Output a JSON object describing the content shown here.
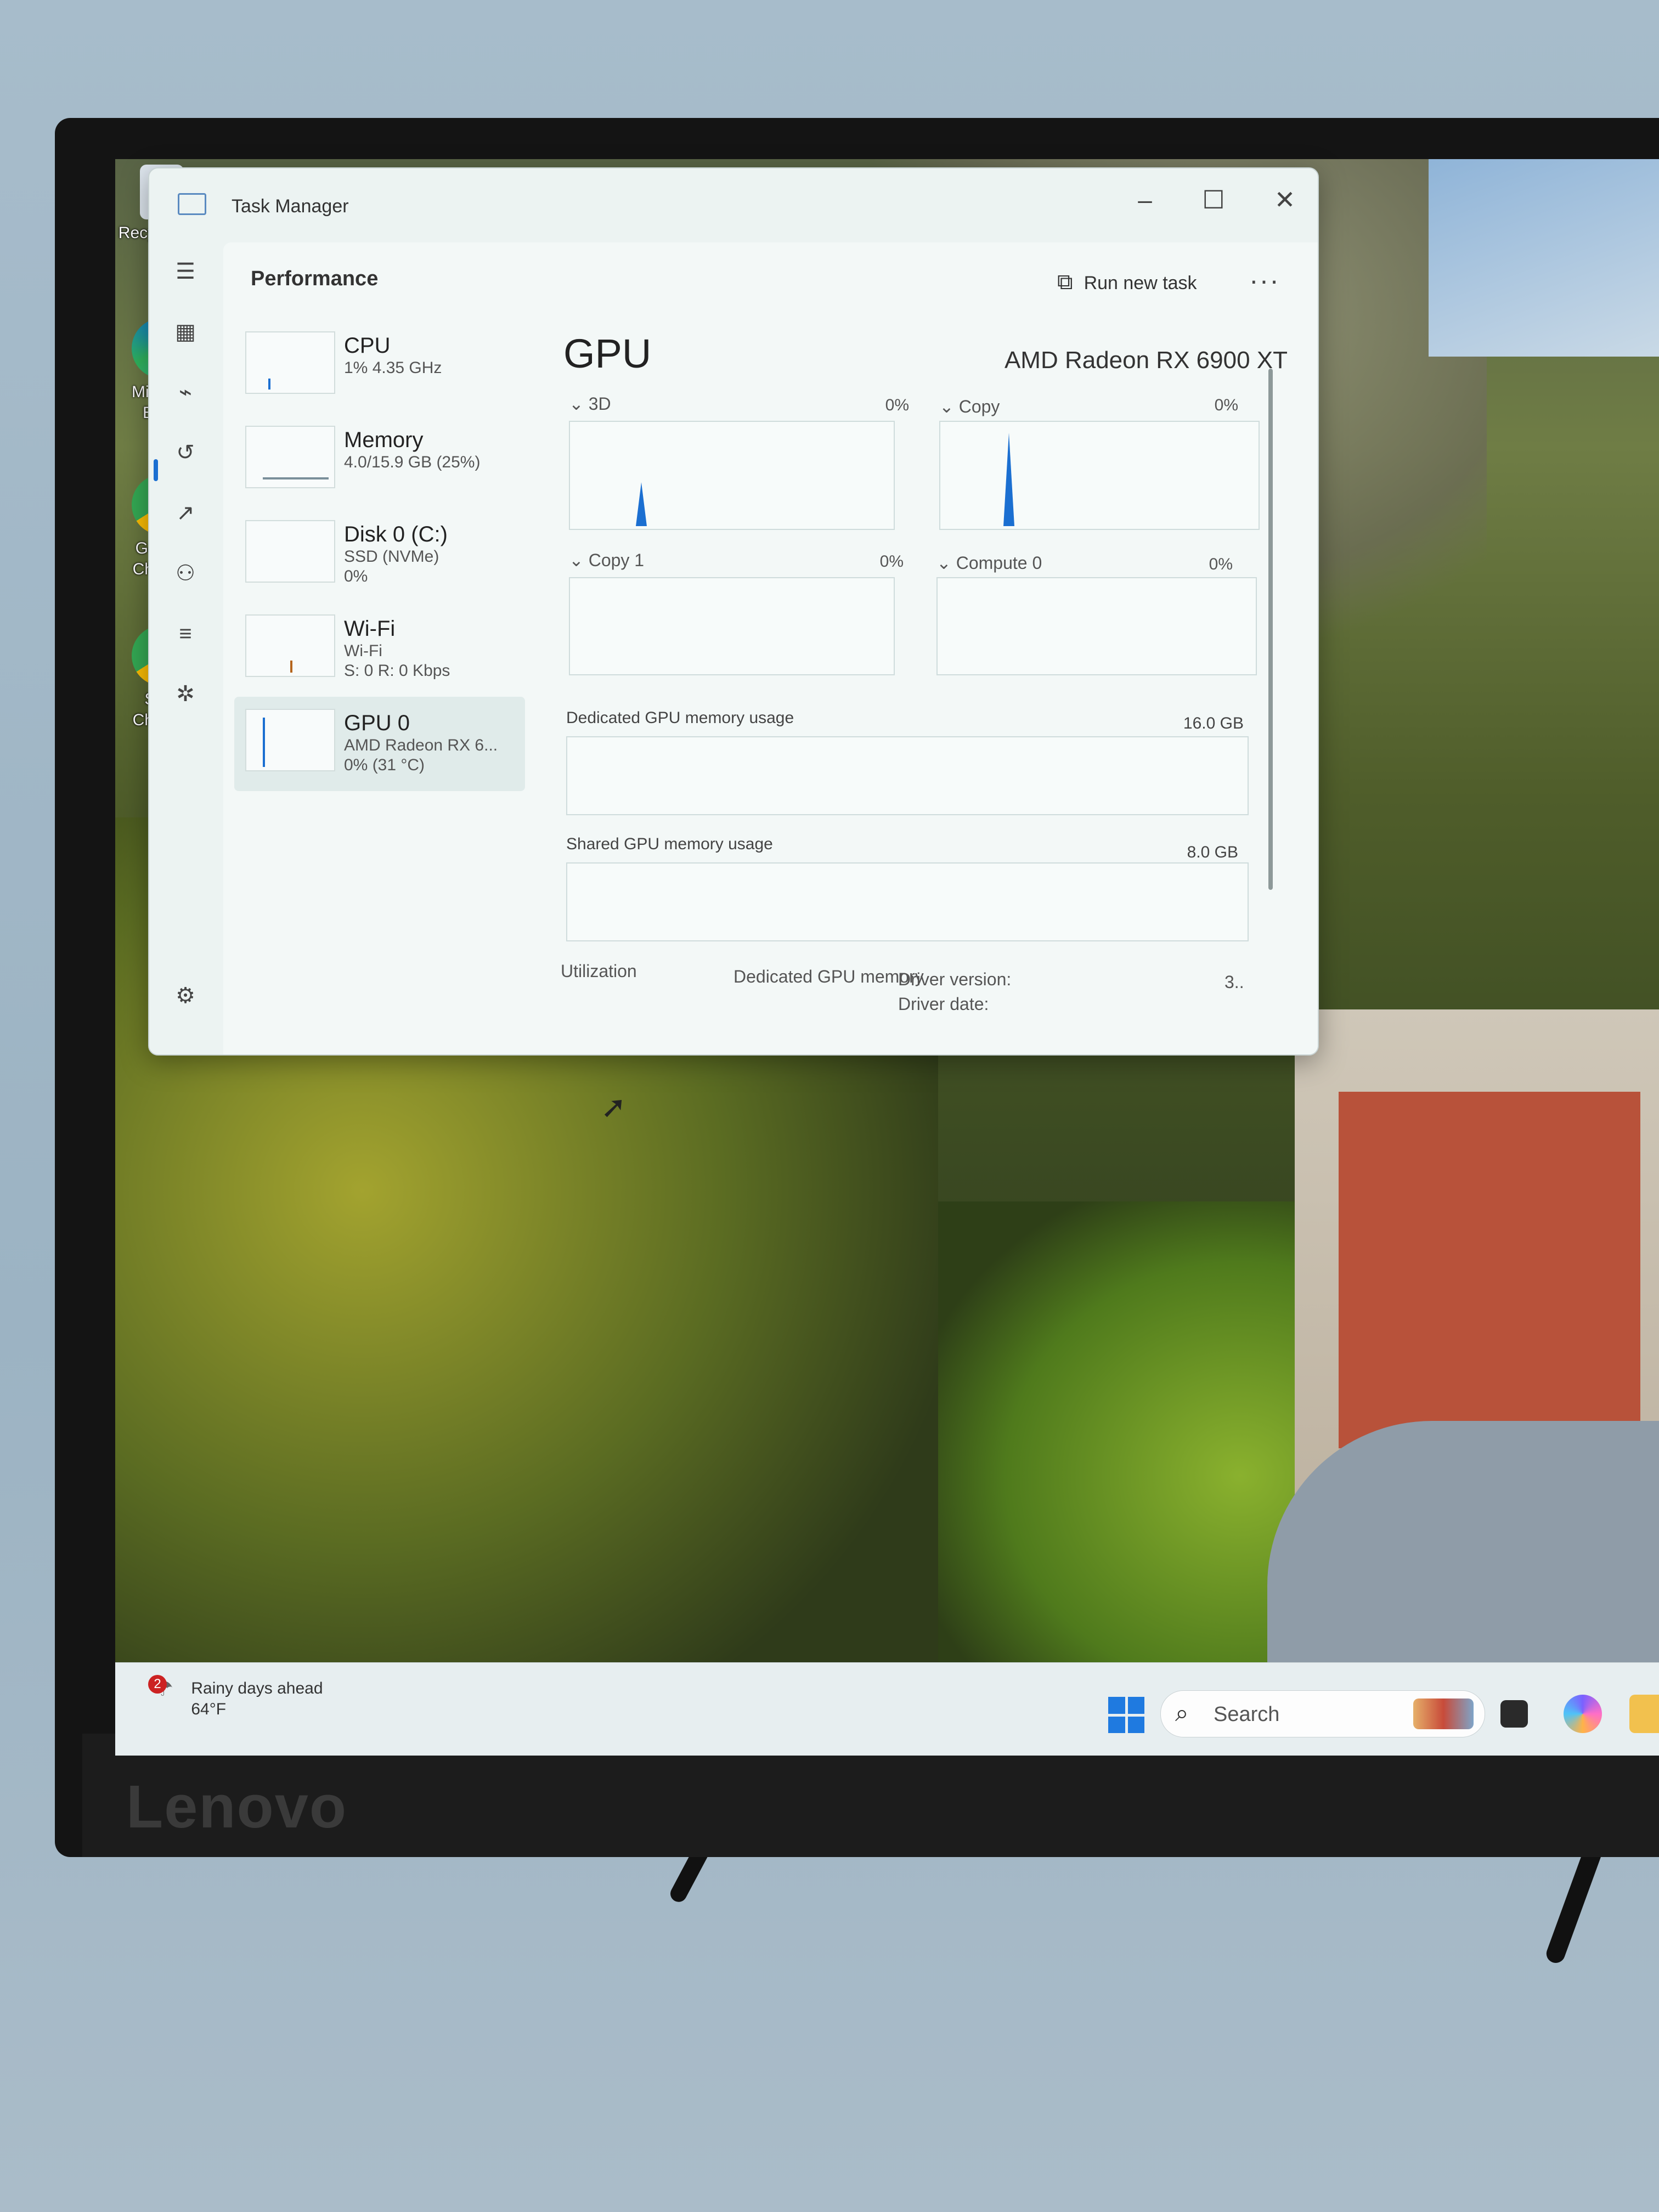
{
  "desktop": {
    "icons": [
      {
        "label": "Recycle Bin",
        "icon": "recycle-bin-icon"
      },
      {
        "label": "Microsoft Edge",
        "icon": "edge-icon"
      },
      {
        "label": "Google Chrome",
        "icon": "chrome-icon"
      },
      {
        "label": "SVG Chrome",
        "icon": "chrome-profile-icon"
      }
    ]
  },
  "monitor": {
    "brand": "Lenovo"
  },
  "task_manager": {
    "title": "Task Manager",
    "page_title": "Performance",
    "run_new_task": "Run new task",
    "more": "···",
    "resources": [
      {
        "name": "CPU",
        "line1": "1% 4.35 GHz",
        "line2": ""
      },
      {
        "name": "Memory",
        "line1": "4.0/15.9 GB (25%)",
        "line2": ""
      },
      {
        "name": "Disk 0 (C:)",
        "line1": "SSD (NVMe)",
        "line2": "0%"
      },
      {
        "name": "Wi-Fi",
        "line1": "Wi-Fi",
        "line2": "S: 0 R: 0 Kbps"
      },
      {
        "name": "GPU 0",
        "line1": "AMD Radeon RX 6...",
        "line2": "0% (31 °C)"
      }
    ],
    "gpu": {
      "heading": "GPU",
      "model": "AMD Radeon RX 6900 XT",
      "engines": [
        {
          "label": "3D",
          "pct": "0%"
        },
        {
          "label": "Copy",
          "pct": "0%"
        },
        {
          "label": "Copy 1",
          "pct": "0%"
        },
        {
          "label": "Compute 0",
          "pct": "0%"
        }
      ],
      "dedicated_label": "Dedicated GPU memory usage",
      "dedicated_max": "16.0 GB",
      "shared_label": "Shared GPU memory usage",
      "shared_max": "8.0 GB",
      "stats": {
        "utilization": "Utilization",
        "dedicated_memory": "Dedicated GPU memory",
        "driver_version": "Driver version:",
        "driver_date": "Driver date:",
        "driver_version_value": "3.."
      }
    }
  },
  "taskbar": {
    "weather_badge": "2",
    "weather_title": "Rainy days ahead",
    "weather_temp": "64°F",
    "search_placeholder": "Search"
  },
  "colors": {
    "accent": "#1b6fd1",
    "taskbar": "#e7eef0",
    "window_bg": "#ecf3f2"
  }
}
